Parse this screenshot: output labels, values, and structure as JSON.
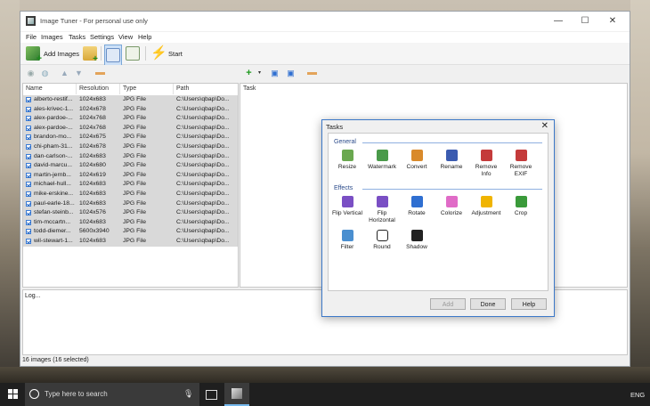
{
  "window": {
    "title": "Image Tuner - For personal use only",
    "minimize": "—",
    "maximize": "☐",
    "close": "✕"
  },
  "menu": [
    "File",
    "Images",
    "Tasks",
    "Settings",
    "View",
    "Help"
  ],
  "toolbar": {
    "add_images": "Add Images",
    "start": "Start"
  },
  "columns": {
    "name": "Name",
    "resolution": "Resolution",
    "type": "Type",
    "path": "Path",
    "task": "Task"
  },
  "files": [
    {
      "name": "alberto-restif...",
      "resolution": "1024x683",
      "type": "JPG File",
      "path": "C:\\Users\\qbap\\Do..."
    },
    {
      "name": "ales-krivec-1...",
      "resolution": "1024x678",
      "type": "JPG File",
      "path": "C:\\Users\\qbap\\Do..."
    },
    {
      "name": "alex-pardoe-...",
      "resolution": "1024x768",
      "type": "JPG File",
      "path": "C:\\Users\\qbap\\Do..."
    },
    {
      "name": "alex-pardoe-...",
      "resolution": "1024x768",
      "type": "JPG File",
      "path": "C:\\Users\\qbap\\Do..."
    },
    {
      "name": "brandon-mo...",
      "resolution": "1024x675",
      "type": "JPG File",
      "path": "C:\\Users\\qbap\\Do..."
    },
    {
      "name": "chi-pham-31...",
      "resolution": "1024x678",
      "type": "JPG File",
      "path": "C:\\Users\\qbap\\Do..."
    },
    {
      "name": "dan-carlson-...",
      "resolution": "1024x683",
      "type": "JPG File",
      "path": "C:\\Users\\qbap\\Do..."
    },
    {
      "name": "david-marcu...",
      "resolution": "1024x680",
      "type": "JPG File",
      "path": "C:\\Users\\qbap\\Do..."
    },
    {
      "name": "martin-jernb...",
      "resolution": "1024x619",
      "type": "JPG File",
      "path": "C:\\Users\\qbap\\Do..."
    },
    {
      "name": "michael-hull...",
      "resolution": "1024x683",
      "type": "JPG File",
      "path": "C:\\Users\\qbap\\Do..."
    },
    {
      "name": "mike-erskine...",
      "resolution": "1024x683",
      "type": "JPG File",
      "path": "C:\\Users\\qbap\\Do..."
    },
    {
      "name": "paul-earle-18...",
      "resolution": "1024x683",
      "type": "JPG File",
      "path": "C:\\Users\\qbap\\Do..."
    },
    {
      "name": "stefan-steinb...",
      "resolution": "1024x576",
      "type": "JPG File",
      "path": "C:\\Users\\qbap\\Do..."
    },
    {
      "name": "tim-mccartn...",
      "resolution": "1024x683",
      "type": "JPG File",
      "path": "C:\\Users\\qbap\\Do..."
    },
    {
      "name": "todd-diemer...",
      "resolution": "5600x3940",
      "type": "JPG File",
      "path": "C:\\Users\\qbap\\Do..."
    },
    {
      "name": "wil-stewart-1...",
      "resolution": "1024x683",
      "type": "JPG File",
      "path": "C:\\Users\\qbap\\Do..."
    }
  ],
  "log_label": "Log...",
  "status": "16 images (16 selected)",
  "taskbar": {
    "search_placeholder": "Type here to search",
    "language": "ENG"
  },
  "dialog": {
    "title": "Tasks",
    "general_label": "General",
    "effects_label": "Effects",
    "general": [
      {
        "l1": "Resize",
        "l2": "",
        "color": "#6aa84f"
      },
      {
        "l1": "Watermark",
        "l2": "",
        "color": "#4a9a4a"
      },
      {
        "l1": "Convert",
        "l2": "",
        "color": "#d98a2b"
      },
      {
        "l1": "Rename",
        "l2": "",
        "color": "#3b5bb0"
      },
      {
        "l1": "Remove",
        "l2": "Info",
        "color": "#c43b3b"
      },
      {
        "l1": "Remove",
        "l2": "EXIF",
        "color": "#c43b3b"
      }
    ],
    "effects1": [
      {
        "l1": "Flip Vertical",
        "l2": "",
        "color": "#7a4fc4"
      },
      {
        "l1": "Flip",
        "l2": "Horizontal",
        "color": "#7a4fc4"
      },
      {
        "l1": "Rotate",
        "l2": "",
        "color": "#2f6fd1"
      },
      {
        "l1": "Colorize",
        "l2": "",
        "color": "#e06bc7"
      },
      {
        "l1": "Adjustment",
        "l2": "",
        "color": "#f0b400"
      },
      {
        "l1": "Crop",
        "l2": "",
        "color": "#3a9a3a"
      }
    ],
    "effects2": [
      {
        "l1": "Filter",
        "l2": "",
        "color": "#4a8fd0"
      },
      {
        "l1": "Round",
        "l2": "",
        "color": "#ffffff"
      },
      {
        "l1": "Shadow",
        "l2": "",
        "color": "#222222"
      }
    ],
    "add": "Add",
    "done": "Done",
    "help": "Help"
  }
}
